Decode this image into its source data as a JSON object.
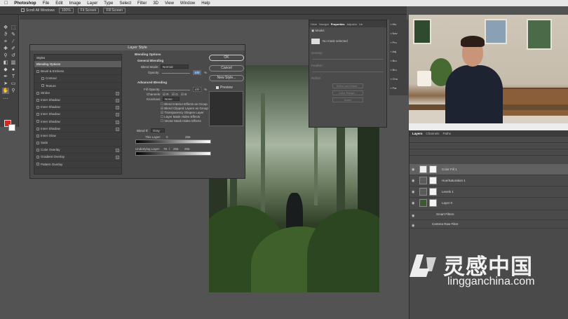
{
  "menubar": {
    "apple": "",
    "app": "Photoshop",
    "items": [
      "File",
      "Edit",
      "Image",
      "Layer",
      "Type",
      "Select",
      "Filter",
      "3D",
      "View",
      "Window",
      "Help"
    ]
  },
  "options_bar": {
    "scroll_all": "Scroll All Windows",
    "zoom": "100%",
    "fit_screen": "Fit Screen",
    "fill_screen": "Fill Screen"
  },
  "layer_style": {
    "title": "Layer Style",
    "styles_header": "Styles",
    "items": [
      {
        "label": "Blending Options",
        "active": true
      },
      {
        "label": "Bevel & Emboss",
        "plus": false
      },
      {
        "label": "Contour",
        "sub": true
      },
      {
        "label": "Texture",
        "sub": true
      },
      {
        "label": "Stroke",
        "plus": true
      },
      {
        "label": "Inner Shadow",
        "plus": true
      },
      {
        "label": "Inner Shadow",
        "plus": true
      },
      {
        "label": "Inner Shadow",
        "plus": true
      },
      {
        "label": "Inner Shadow",
        "plus": true
      },
      {
        "label": "Inner Shadow",
        "plus": true
      },
      {
        "label": "Inner Glow",
        "plus": false
      },
      {
        "label": "Satin",
        "plus": false
      },
      {
        "label": "Color Overlay",
        "plus": true
      },
      {
        "label": "Gradient Overlay",
        "plus": true
      },
      {
        "label": "Pattern Overlay",
        "plus": false
      }
    ],
    "blending_options": "Blending Options",
    "general_blending": "General Blending",
    "blend_mode_label": "Blend Mode:",
    "blend_mode_value": "Normal",
    "opacity_label": "Opacity:",
    "opacity_value": "100",
    "opacity_unit": "%",
    "advanced_blending": "Advanced Blending",
    "fill_opacity_label": "Fill Opacity:",
    "fill_opacity_value": "100",
    "fill_opacity_unit": "%",
    "channels_label": "Channels:",
    "channels": [
      "R",
      "G",
      "B"
    ],
    "knockout_label": "Knockout:",
    "knockout_value": "None",
    "options": [
      "Blend Interior Effects as Group",
      "Blend Clipped Layers as Group",
      "Transparency Shapes Layer",
      "Layer Mask Hides Effects",
      "Vector Mask Hides Effects"
    ],
    "blend_if_label": "Blend If:",
    "blend_if_value": "Gray",
    "this_layer_label": "This Layer:",
    "this_layer_min": "0",
    "this_layer_max": "255",
    "underlying_label": "Underlying Layer:",
    "underlying_vals": [
      "78",
      "/",
      "255",
      "255"
    ],
    "ok": "OK",
    "cancel": "Cancel",
    "new_style": "New Style...",
    "preview": "Preview"
  },
  "properties": {
    "tabs": [
      "Histo",
      "Navigat",
      "Properties",
      "Adjustm",
      "Lib"
    ],
    "active_tab": "Properties",
    "mask_label": "Masks",
    "no_mask": "No mask selected",
    "density": "Density:",
    "feather": "Feather:",
    "refine": "Refine:",
    "select_mask": "Select and Mask...",
    "color_range": "Color Range...",
    "invert": "Invert"
  },
  "icon_strip": [
    "His",
    "Nav",
    "Pro",
    "Adj",
    "Bru",
    "Bru",
    "Cha",
    "Par"
  ],
  "layers": {
    "tabs": [
      "Layers",
      "Channels",
      "Paths"
    ],
    "active_tab": "Layers",
    "rows": [
      {
        "name": "Color Fill 1",
        "selected": true
      },
      {
        "name": "Hue/Saturation 1",
        "selected": false
      },
      {
        "name": "Levels 1",
        "selected": false
      },
      {
        "name": "Layer 0",
        "selected": false
      },
      {
        "name": "Smart Filters",
        "selected": false
      },
      {
        "name": "Camera Raw Filter",
        "selected": false
      }
    ]
  },
  "watermark": {
    "text": "灵感中国",
    "url": "lingganchina.com"
  },
  "colors": {
    "foreground": "#d8261f",
    "background": "#ffffff",
    "accent": "#3a6db4"
  }
}
